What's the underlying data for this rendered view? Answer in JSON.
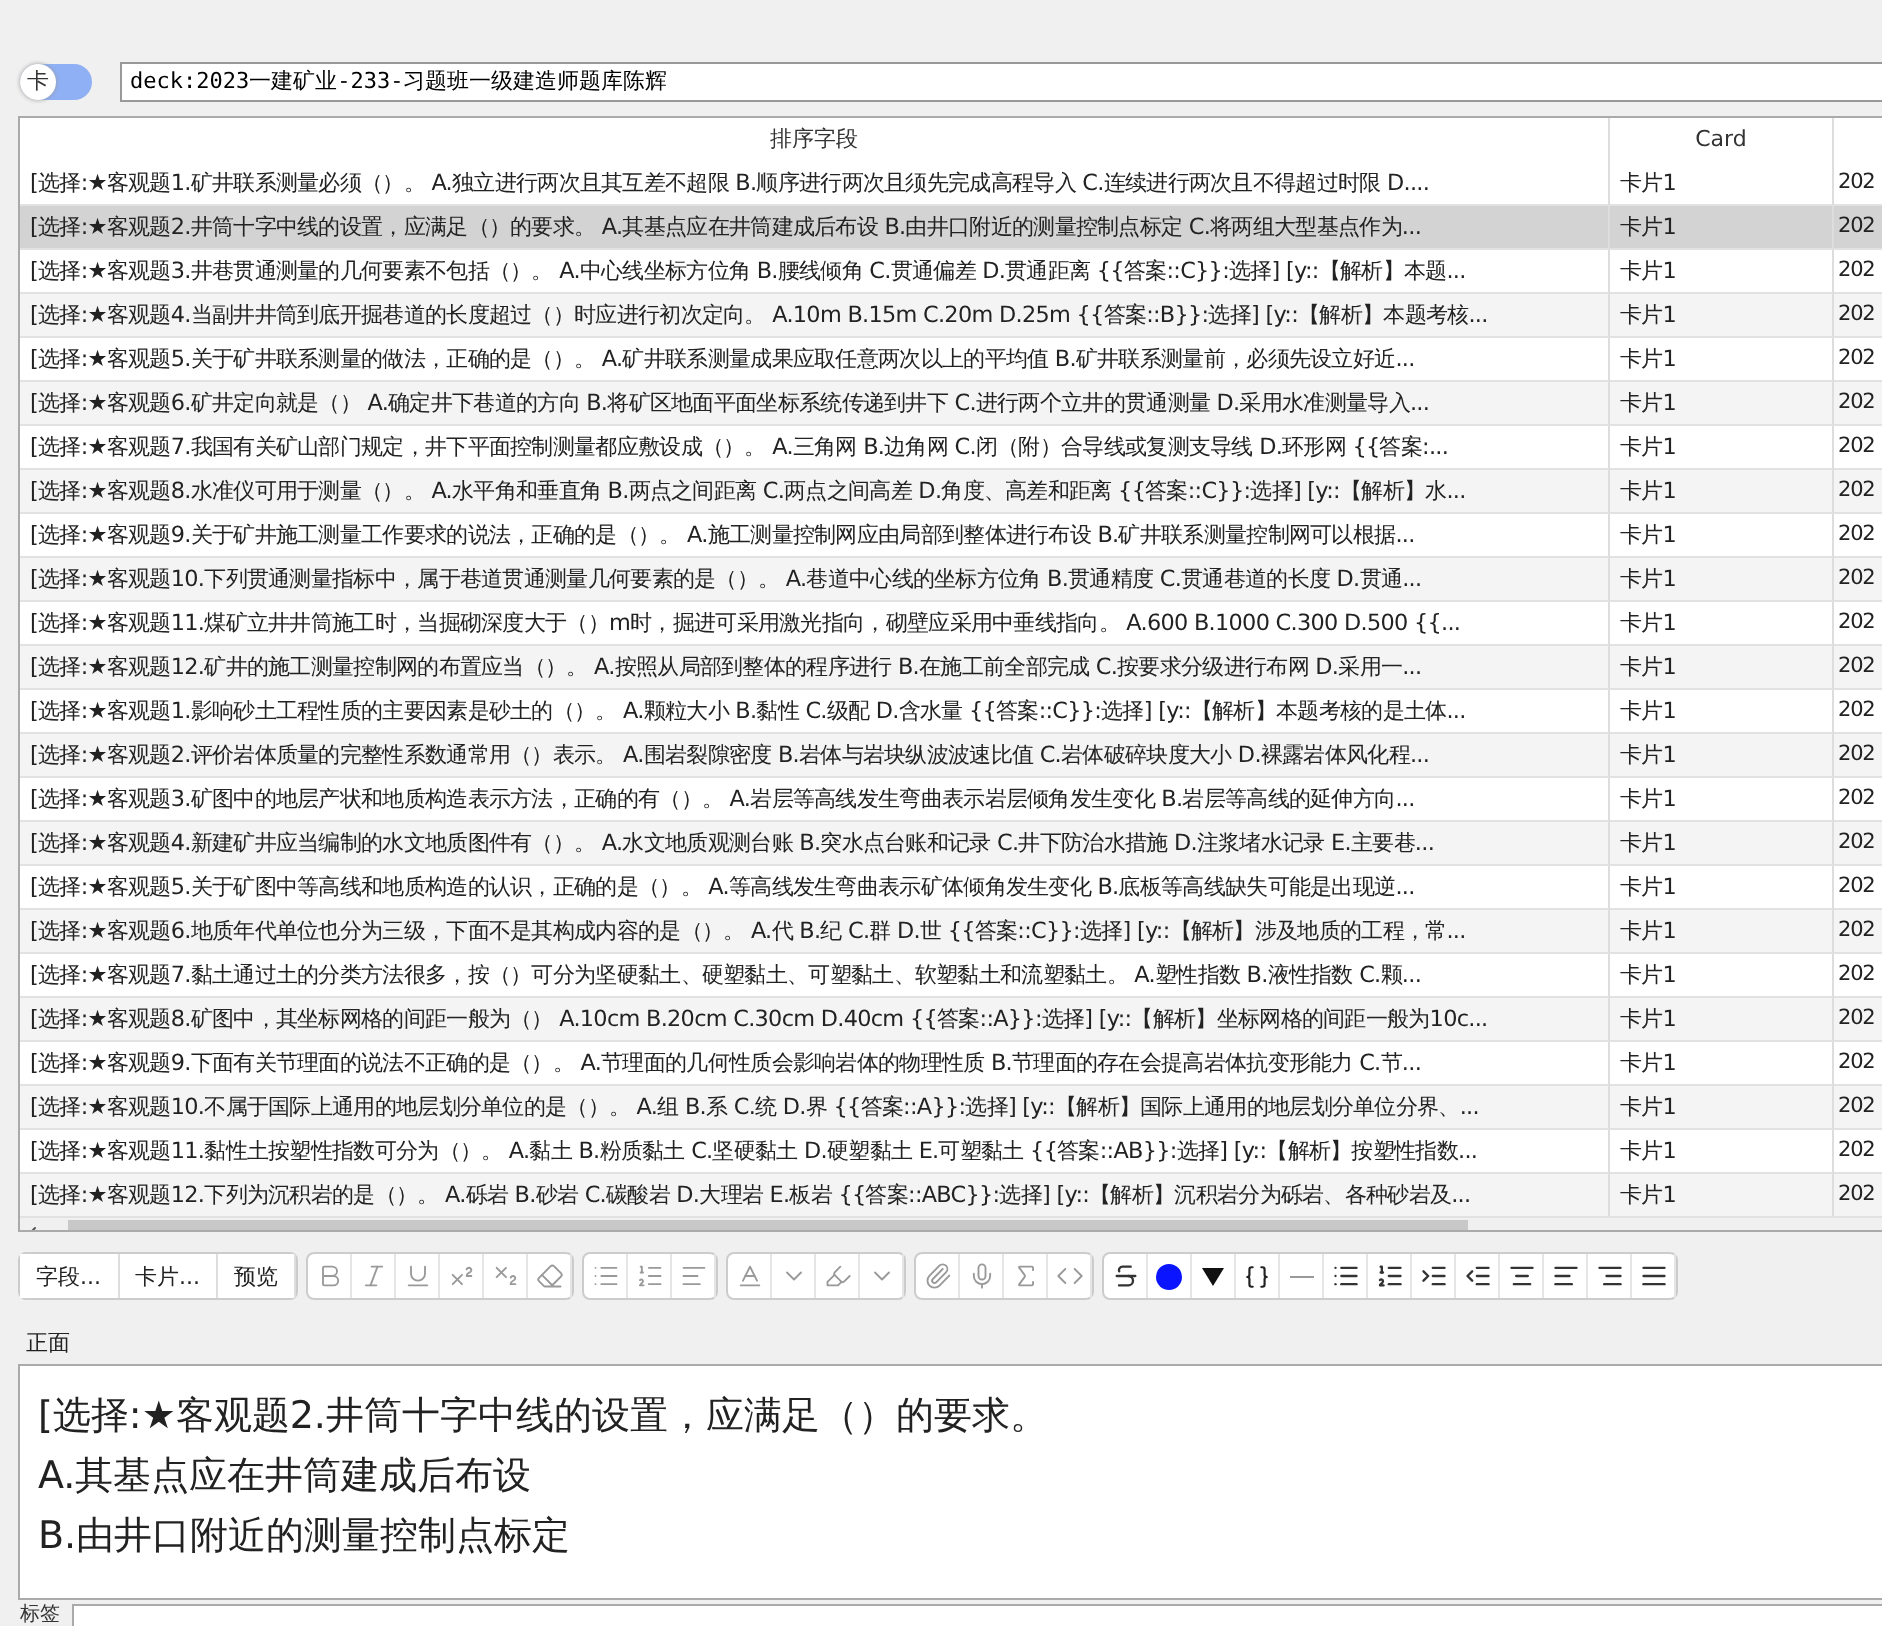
{
  "mode_toggle": {
    "label": "卡",
    "on": false
  },
  "deck_field": {
    "value": "deck:2023一建矿业-233-习题班一级建造师题库陈辉"
  },
  "table": {
    "columns": [
      "排序字段",
      "Card",
      ""
    ],
    "rows": [
      {
        "cells": [
          "[选择:★客观题1.矿井联系测量必须（）。 A.独立进行两次且其互差不超限 B.顺序进行两次且须先完成高程导入 C.连续进行两次且不得超过时限 D....",
          "卡片1",
          "202"
        ],
        "selected": false
      },
      {
        "cells": [
          "[选择:★客观题2.井筒十字中线的设置，应满足（）的要求。 A.其基点应在井筒建成后布设 B.由井口附近的测量控制点标定 C.将两组大型基点作为...",
          "卡片1",
          "202"
        ],
        "selected": true
      },
      {
        "cells": [
          "[选择:★客观题3.井巷贯通测量的几何要素不包括（）。 A.中心线坐标方位角 B.腰线倾角 C.贯通偏差 D.贯通距离 {{答案::C}}:选择] [y::【解析】本题...",
          "卡片1",
          "202"
        ],
        "selected": false
      },
      {
        "cells": [
          "[选择:★客观题4.当副井井筒到底开掘巷道的长度超过（）时应进行初次定向。 A.10m B.15m C.20m D.25m {{答案::B}}:选择] [y::【解析】本题考核...",
          "卡片1",
          "202"
        ],
        "selected": false
      },
      {
        "cells": [
          "[选择:★客观题5.关于矿井联系测量的做法，正确的是（）。 A.矿井联系测量成果应取任意两次以上的平均值 B.矿井联系测量前，必须先设立好近...",
          "卡片1",
          "202"
        ],
        "selected": false
      },
      {
        "cells": [
          "[选择:★客观题6.矿井定向就是（） A.确定井下巷道的方向 B.将矿区地面平面坐标系统传递到井下 C.进行两个立井的贯通测量 D.采用水准测量导入...",
          "卡片1",
          "202"
        ],
        "selected": false
      },
      {
        "cells": [
          "[选择:★客观题7.我国有关矿山部门规定，井下平面控制测量都应敷设成（）。 A.三角网 B.边角网 C.闭（附）合导线或复测支导线 D.环形网 {{答案:...",
          "卡片1",
          "202"
        ],
        "selected": false
      },
      {
        "cells": [
          "[选择:★客观题8.水准仪可用于测量（）。 A.水平角和垂直角 B.两点之间距离 C.两点之间高差 D.角度、高差和距离 {{答案::C}}:选择] [y::【解析】水...",
          "卡片1",
          "202"
        ],
        "selected": false
      },
      {
        "cells": [
          "[选择:★客观题9.关于矿井施工测量工作要求的说法，正确的是（）。 A.施工测量控制网应由局部到整体进行布设 B.矿井联系测量控制网可以根据...",
          "卡片1",
          "202"
        ],
        "selected": false
      },
      {
        "cells": [
          "[选择:★客观题10.下列贯通测量指标中，属于巷道贯通测量几何要素的是（）。 A.巷道中心线的坐标方位角 B.贯通精度 C.贯通巷道的长度 D.贯通...",
          "卡片1",
          "202"
        ],
        "selected": false
      },
      {
        "cells": [
          "[选择:★客观题11.煤矿立井井筒施工时，当掘砌深度大于（）m时，掘进可采用激光指向，砌壁应采用中垂线指向。 A.600 B.1000 C.300 D.500 {{...",
          "卡片1",
          "202"
        ],
        "selected": false
      },
      {
        "cells": [
          "[选择:★客观题12.矿井的施工测量控制网的布置应当（）。 A.按照从局部到整体的程序进行 B.在施工前全部完成 C.按要求分级进行布网 D.采用一...",
          "卡片1",
          "202"
        ],
        "selected": false
      },
      {
        "cells": [
          "[选择:★客观题1.影响砂土工程性质的主要因素是砂土的（）。 A.颗粒大小 B.黏性 C.级配 D.含水量 {{答案::C}}:选择] [y::【解析】本题考核的是土体...",
          "卡片1",
          "202"
        ],
        "selected": false
      },
      {
        "cells": [
          "[选择:★客观题2.评价岩体质量的完整性系数通常用（）表示。 A.围岩裂隙密度 B.岩体与岩块纵波波速比值 C.岩体破碎块度大小 D.裸露岩体风化程...",
          "卡片1",
          "202"
        ],
        "selected": false
      },
      {
        "cells": [
          "[选择:★客观题3.矿图中的地层产状和地质构造表示方法，正确的有（）。 A.岩层等高线发生弯曲表示岩层倾角发生变化 B.岩层等高线的延伸方向...",
          "卡片1",
          "202"
        ],
        "selected": false
      },
      {
        "cells": [
          "[选择:★客观题4.新建矿井应当编制的水文地质图件有（）。 A.水文地质观测台账 B.突水点台账和记录 C.井下防治水措施 D.注浆堵水记录 E.主要巷...",
          "卡片1",
          "202"
        ],
        "selected": false
      },
      {
        "cells": [
          "[选择:★客观题5.关于矿图中等高线和地质构造的认识，正确的是（）。 A.等高线发生弯曲表示矿体倾角发生变化 B.底板等高线缺失可能是出现逆...",
          "卡片1",
          "202"
        ],
        "selected": false
      },
      {
        "cells": [
          "[选择:★客观题6.地质年代单位也分为三级，下面不是其构成内容的是（）。 A.代 B.纪 C.群 D.世 {{答案::C}}:选择] [y::【解析】涉及地质的工程，常...",
          "卡片1",
          "202"
        ],
        "selected": false
      },
      {
        "cells": [
          "[选择:★客观题7.黏土通过土的分类方法很多，按（）可分为坚硬黏土、硬塑黏土、可塑黏土、软塑黏土和流塑黏土。 A.塑性指数 B.液性指数 C.颗...",
          "卡片1",
          "202"
        ],
        "selected": false
      },
      {
        "cells": [
          "[选择:★客观题8.矿图中，其坐标网格的间距一般为（） A.10cm B.20cm C.30cm D.40cm {{答案::A}}:选择] [y::【解析】坐标网格的间距一般为10c...",
          "卡片1",
          "202"
        ],
        "selected": false
      },
      {
        "cells": [
          "[选择:★客观题9.下面有关节理面的说法不正确的是（）。 A.节理面的几何性质会影响岩体的物理性质 B.节理面的存在会提高岩体抗变形能力 C.节...",
          "卡片1",
          "202"
        ],
        "selected": false
      },
      {
        "cells": [
          "[选择:★客观题10.不属于国际上通用的地层划分单位的是（）。 A.组 B.系 C.统 D.界 {{答案::A}}:选择] [y::【解析】国际上通用的地层划分单位分界、...",
          "卡片1",
          "202"
        ],
        "selected": false
      },
      {
        "cells": [
          "[选择:★客观题11.黏性土按塑性指数可分为（）。 A.黏土 B.粉质黏土 C.坚硬黏土 D.硬塑黏土 E.可塑黏土 {{答案::AB}}:选择] [y::【解析】按塑性指数...",
          "卡片1",
          "202"
        ],
        "selected": false
      },
      {
        "cells": [
          "[选择:★客观题12.下列为沉积岩的是（）。 A.砾岩 B.砂岩 C.碳酸岩 D.大理岩 E.板岩 {{答案::ABC}}:选择] [y::【解析】沉积岩分为砾岩、各种砂岩及...",
          "卡片1",
          "202"
        ],
        "selected": false
      }
    ]
  },
  "toolbar": {
    "text_buttons": [
      "字段...",
      "卡片...",
      "预览"
    ]
  },
  "editor": {
    "field_label": "正面",
    "lines": [
      "[选择:★客观题2.井筒十字中线的设置，应满足（）的要求。",
      "A.其基点应在井筒建成后布设",
      "B.由井口附近的测量控制点标定"
    ]
  },
  "tags": {
    "label": "标签"
  }
}
